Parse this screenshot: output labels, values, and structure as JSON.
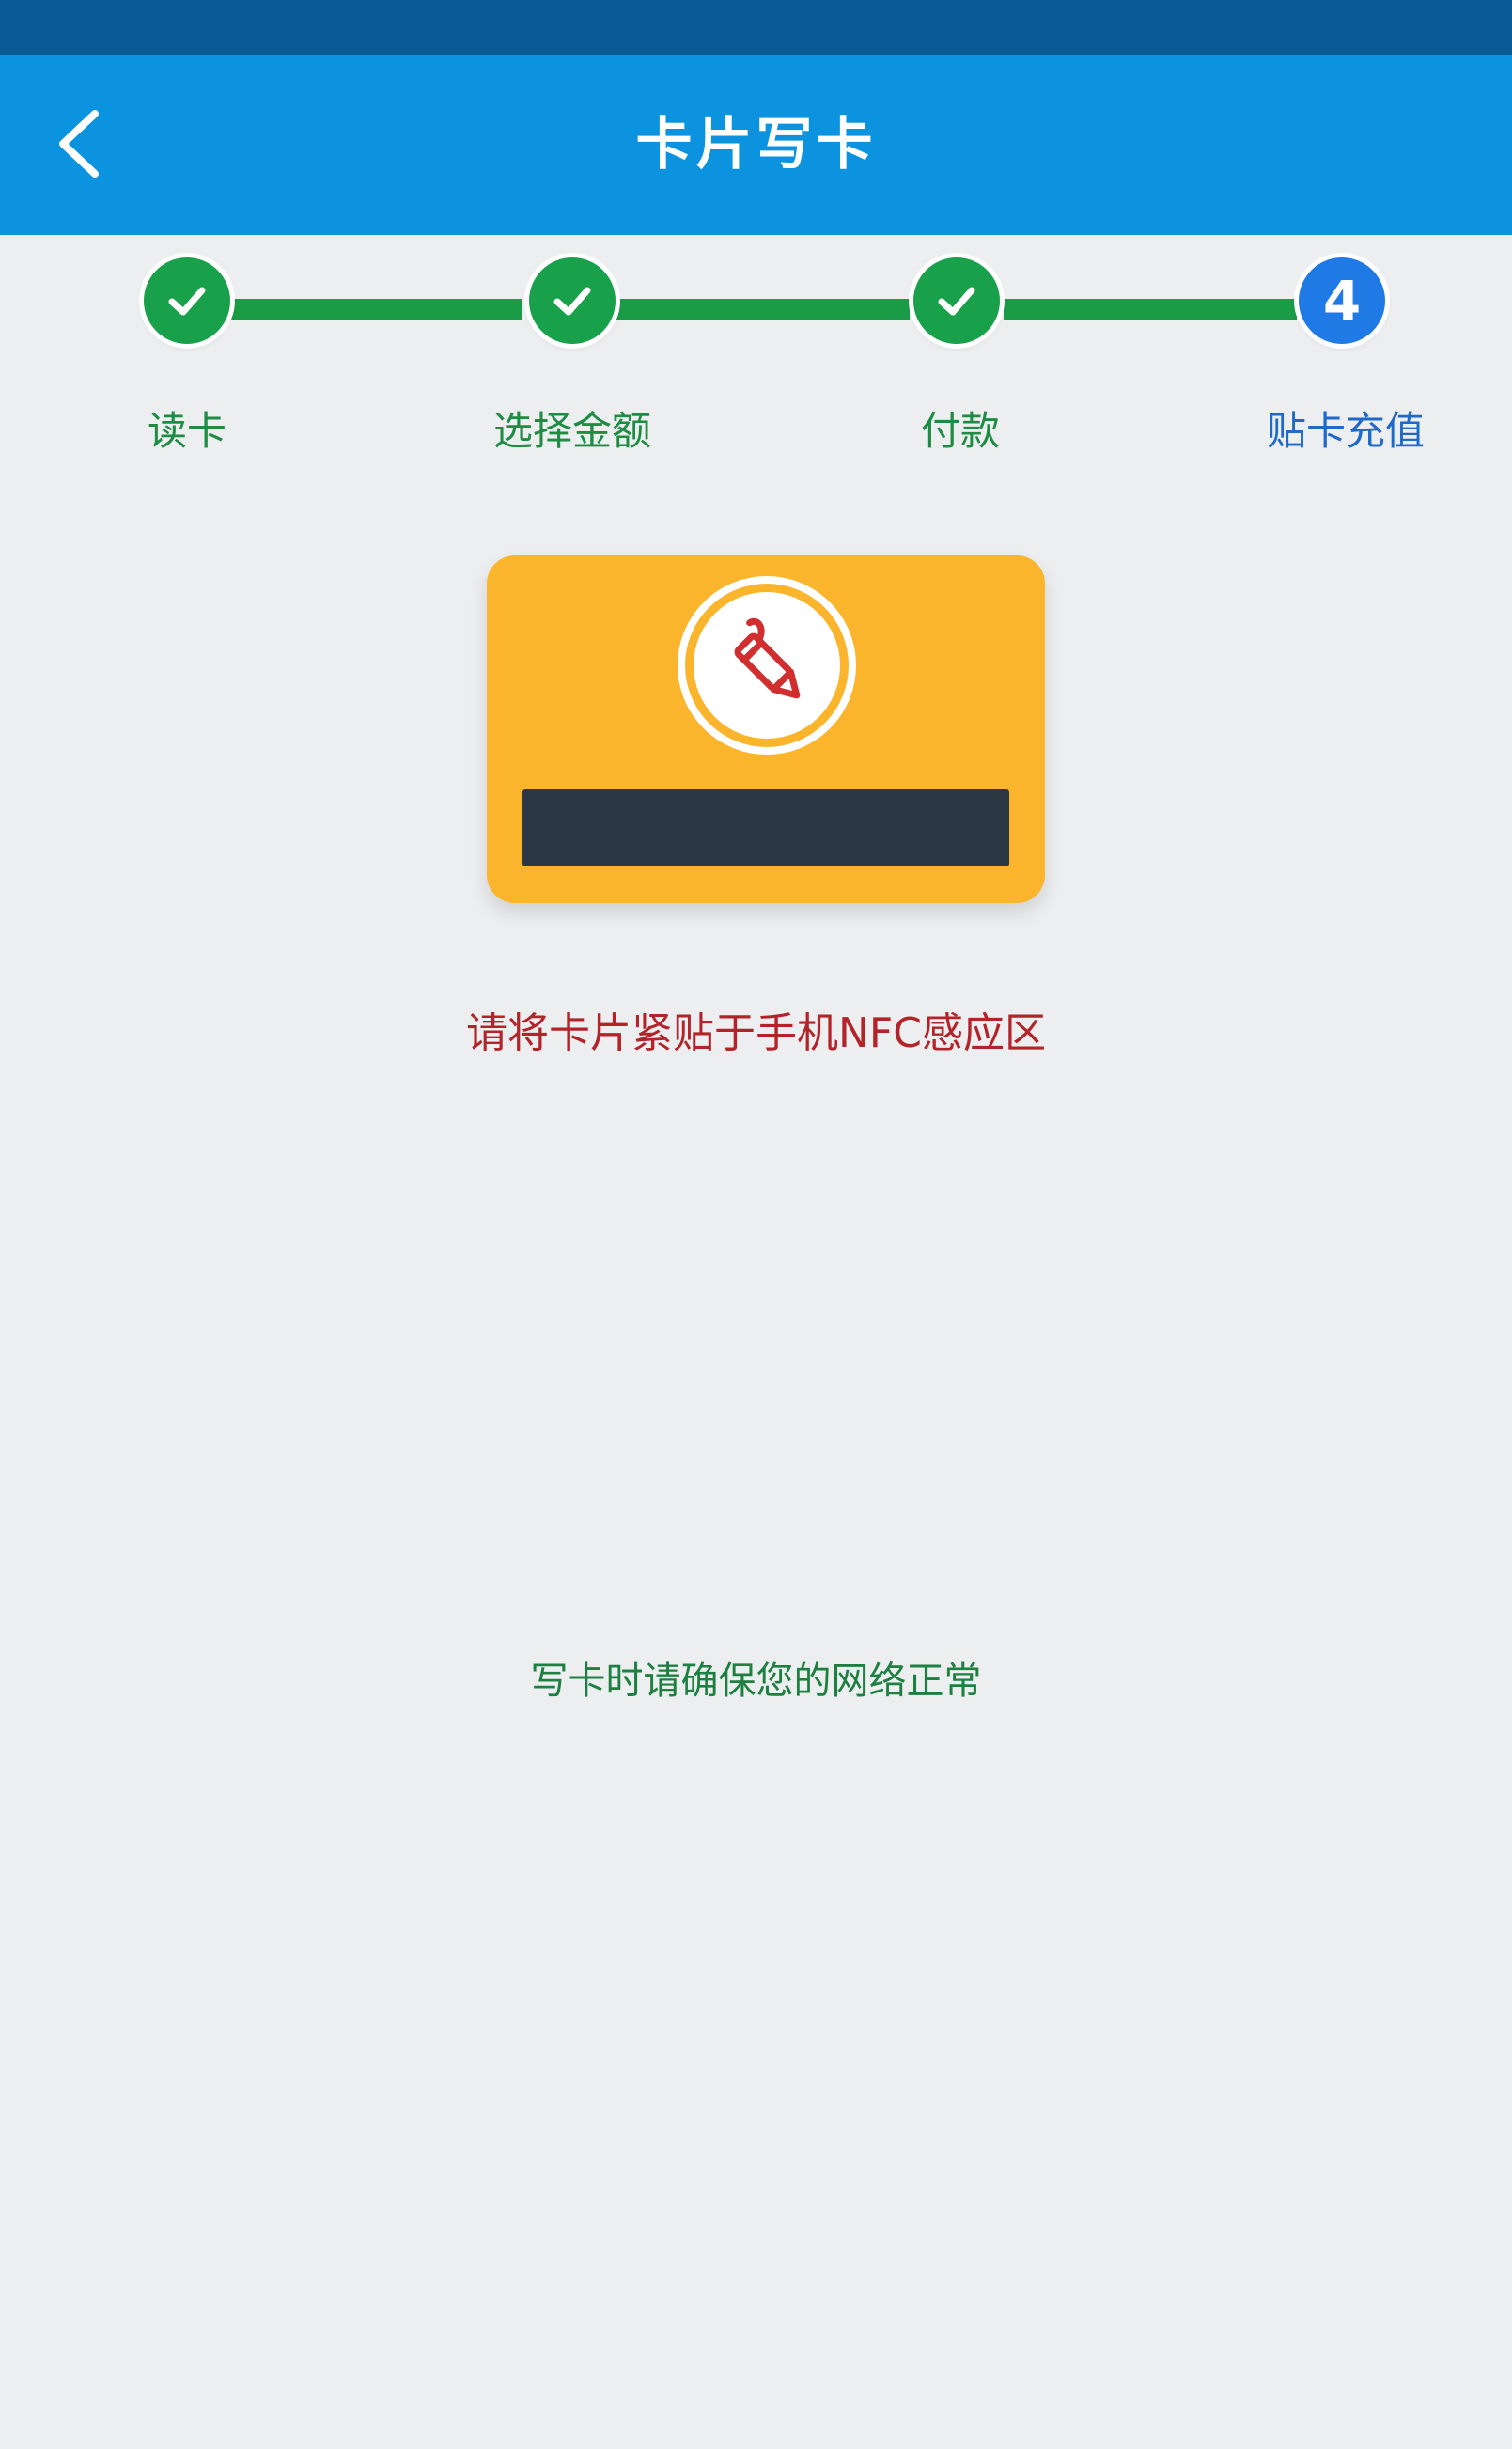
{
  "header": {
    "title": "卡片写卡",
    "back_icon": "chevron-left-icon"
  },
  "steps": [
    {
      "label": "读卡",
      "status": "done",
      "icon": "check-icon"
    },
    {
      "label": "选择金额",
      "status": "done",
      "icon": "check-icon"
    },
    {
      "label": "付款",
      "status": "done",
      "icon": "check-icon"
    },
    {
      "label": "贴卡充值",
      "status": "active",
      "number": "4"
    }
  ],
  "card": {
    "icon": "pencil-icon",
    "color": "#fbb52d"
  },
  "nfc_instruction": "请将卡片紧贴于手机NFC感应区",
  "network_tip": "写卡时请确保您的网络正常",
  "colors": {
    "header": "#0b93e0",
    "status_bar": "#075a93",
    "done": "#18a04a",
    "active": "#1f7ae6",
    "instruction": "#b3242a",
    "tip": "#1e8040"
  }
}
